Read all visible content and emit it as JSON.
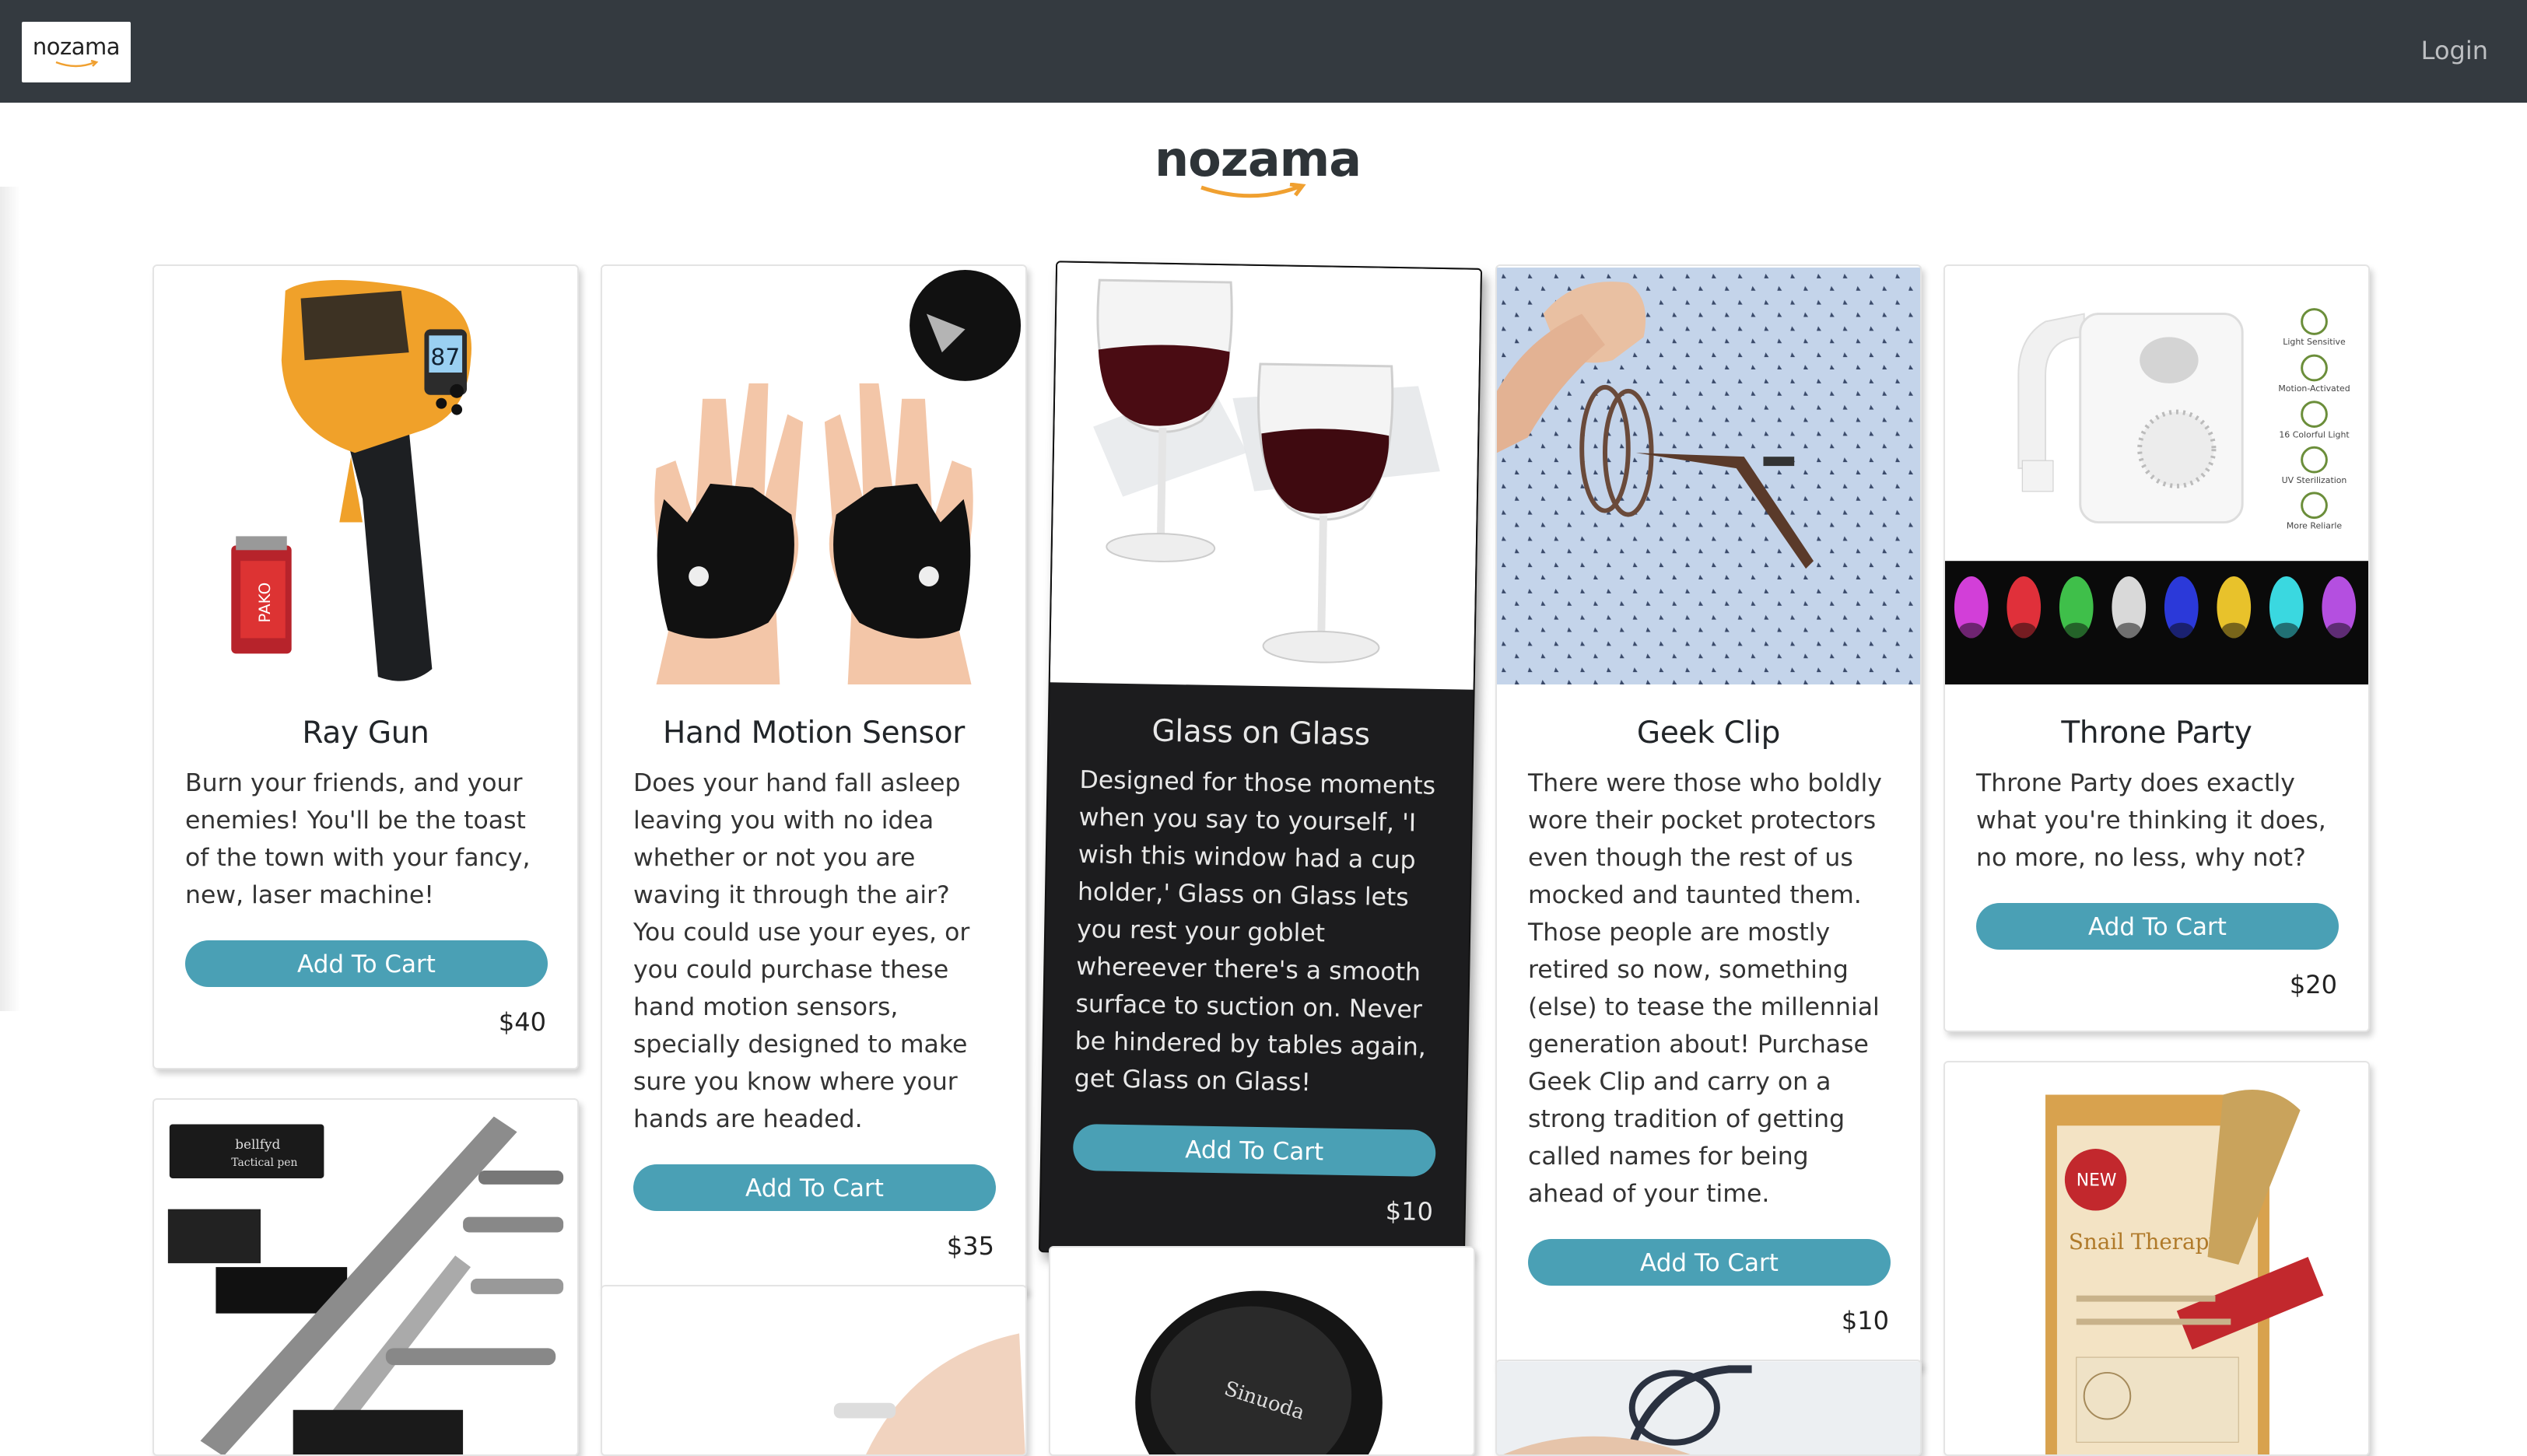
{
  "navbar": {
    "logo_text": "nozama",
    "login_label": "Login",
    "background": "#343a40"
  },
  "brand": {
    "logo_text": "nozama"
  },
  "accent_color": "#4aa0b5",
  "products": [
    {
      "name": "Ray Gun",
      "description": "Burn your friends, and your enemies! You'll be the toast of the town with your fancy, new, laser machine!",
      "button_label": "Add To Cart",
      "price": "$40",
      "image_icon": "infrared-thermometer-icon"
    },
    {
      "name": "Hand Motion Sensor",
      "description": "Does your hand fall asleep leaving you with no idea whether or not you are waving it through the air? You could use your eyes, or you could purchase these hand motion sensors, specially designed to make sure you know where your hands are headed.",
      "button_label": "Add To Cart",
      "price": "$35",
      "image_icon": "led-gloves-icon"
    },
    {
      "name": "Glass on Glass",
      "description": "Designed for those moments when you say to yourself, 'I wish this window had a cup holder,' Glass on Glass lets you rest your goblet whereever there's a smooth surface to suction on. Never be hindered by tables again, get Glass on Glass!",
      "button_label": "Add To Cart",
      "price": "$10",
      "image_icon": "wine-glass-holder-icon"
    },
    {
      "name": "Geek Clip",
      "description": "There were those who boldly wore their pocket protectors even though the rest of us mocked and taunted them. Those people are mostly retired so now, something (else) to tease the millennial generation about! Purchase Geek Clip and carry on a strong tradition of getting called names for being ahead of your time.",
      "button_label": "Add To Cart",
      "price": "$10",
      "image_icon": "glasses-clip-icon"
    },
    {
      "name": "Throne Party",
      "description": "Throne Party does exactly what you're thinking it does, no more, no less, why not?",
      "button_label": "Add To Cart",
      "price": "$20",
      "image_icon": "toilet-light-icon"
    }
  ],
  "throne_party_features": [
    "Light Sensitive",
    "Motion-Activated",
    "16 Colorful Light",
    "UV Sterilization",
    "More Reliarle"
  ],
  "partial_images": {
    "pen_brand": "bellfyd",
    "pen_subtitle": "Tactical pen",
    "mask_brand": "Snail Therapy",
    "mask_badge": "NEW",
    "charger_brand": "Sinuoda"
  }
}
